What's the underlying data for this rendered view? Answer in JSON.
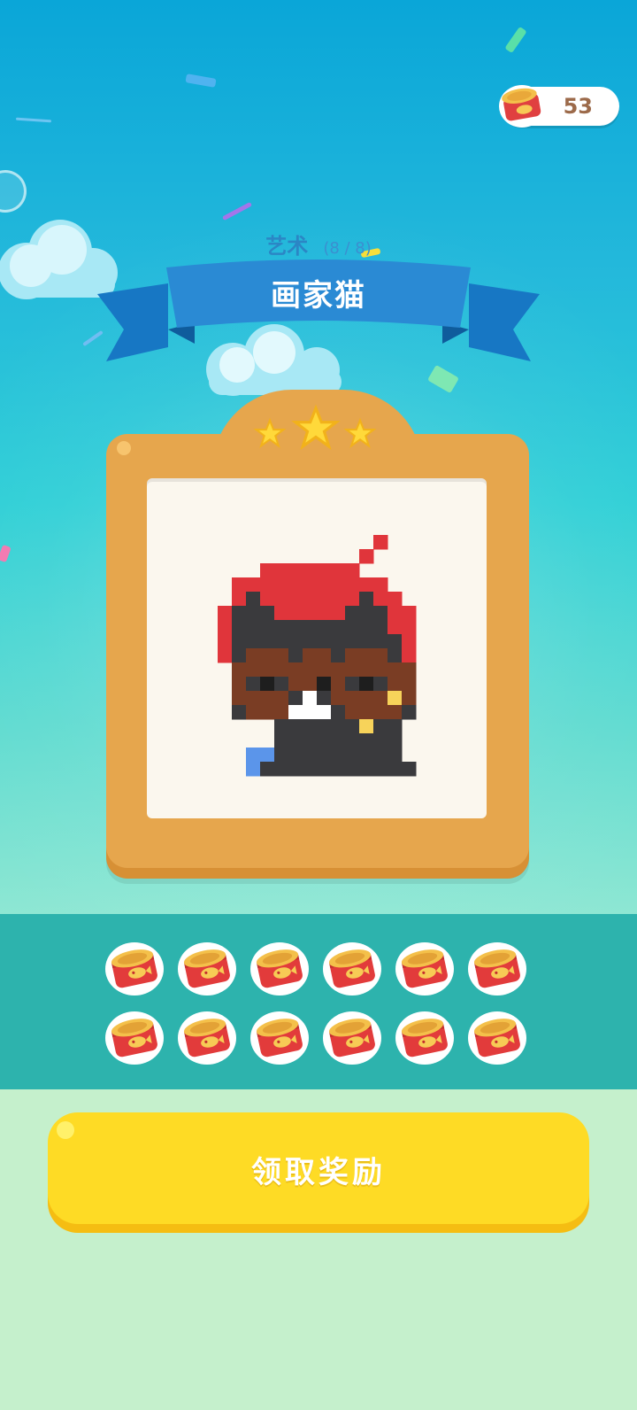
{
  "header": {
    "coin_count": "53",
    "coin_icon": "tuna-can-icon"
  },
  "achievement": {
    "category": "艺术",
    "progress": "(8 / 8)",
    "title": "画家猫",
    "stars_earned": 3,
    "stars_total": 3
  },
  "artwork": {
    "subject": "pixel-art cat wearing red beret and glasses"
  },
  "rewards": {
    "item_icon": "tuna-can-icon",
    "count": 12
  },
  "actions": {
    "claim_label": "领取奖励"
  },
  "colors": {
    "accent_yellow": "#fedb25",
    "frame_orange": "#e6a64d",
    "ribbon_blue": "#1f7fce",
    "band_teal": "#2db3ad",
    "bottom_mint": "#c5f0cc"
  }
}
